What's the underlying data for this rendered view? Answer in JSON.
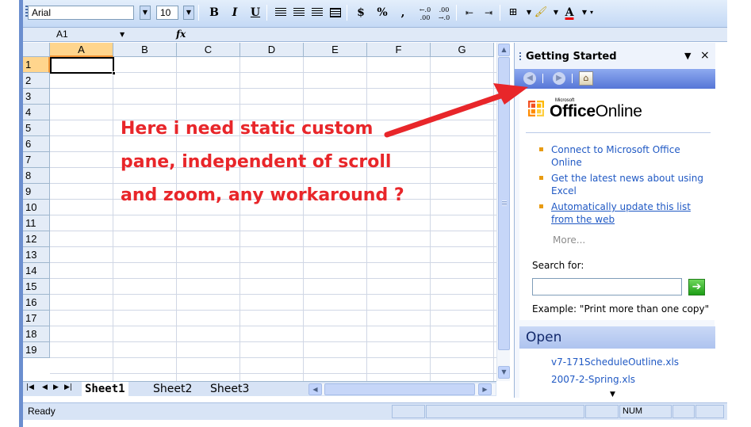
{
  "toolbar": {
    "font_name": "Arial",
    "font_size": "10",
    "bold_label": "B",
    "italic_label": "I",
    "underline_label": "U",
    "currency_label": "$",
    "percent_label": "%",
    "comma_label": ",",
    "increase_decimal_label": "+.0 .00",
    "decrease_decimal_label": ".00 →.0"
  },
  "formula_bar": {
    "name_box": "A1",
    "fx_label": "fx"
  },
  "grid": {
    "columns": [
      "A",
      "B",
      "C",
      "D",
      "E",
      "F",
      "G"
    ],
    "rows": [
      "1",
      "2",
      "3",
      "4",
      "5",
      "6",
      "7",
      "8",
      "9",
      "10",
      "11",
      "12",
      "13",
      "14",
      "15",
      "16",
      "17",
      "18",
      "19"
    ],
    "selected_cell": "A1"
  },
  "sheet_tabs": [
    "Sheet1",
    "Sheet2",
    "Sheet3"
  ],
  "active_sheet": "Sheet1",
  "status_bar": {
    "status": "Ready",
    "num_indicator": "NUM"
  },
  "task_pane": {
    "title": "Getting Started",
    "brand_small": "Microsoft",
    "brand_office": "Office",
    "brand_online": "Online",
    "links": [
      "Connect to Microsoft Office Online",
      "Get the latest news about using Excel",
      "Automatically update this list from the web"
    ],
    "more": "More...",
    "search_label": "Search for:",
    "search_value": "",
    "example": "Example:  \"Print more than one copy\"",
    "open_header": "Open",
    "open_files": [
      "v7-171ScheduleOutline.xls",
      "2007-2-Spring.xls"
    ]
  },
  "annotation": {
    "lines": [
      "Here i need static custom",
      "pane, independent of scroll",
      "and zoom, any workaround ?"
    ],
    "color": "#e8262a"
  },
  "colors": {
    "toolbar_bg": "#c4d9f5",
    "header_bg": "#e4ecf7",
    "selected_header": "#ffd58d",
    "link": "#2059c4",
    "task_pane_nav": "#5676d7"
  }
}
